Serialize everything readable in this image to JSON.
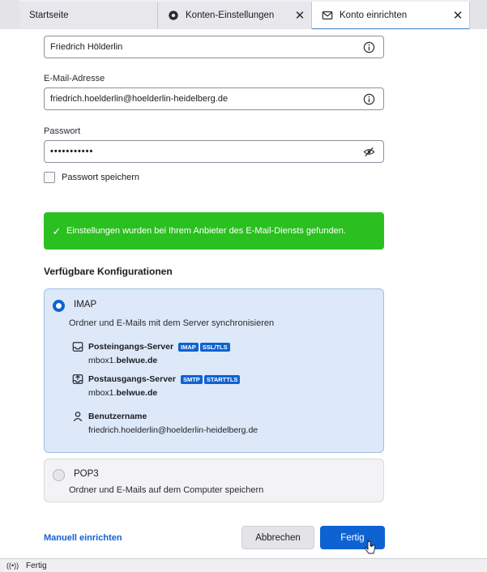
{
  "tabs": [
    {
      "label": "Startseite"
    },
    {
      "label": "Konten-Einstellungen",
      "icon": "gear-icon",
      "close": "✕"
    },
    {
      "label": "Konto einrichten",
      "icon": "envelope-icon",
      "close": "✕"
    }
  ],
  "form": {
    "name_value": "Friedrich Hölderlin",
    "email_label": "E-Mail-Adresse",
    "email_value": "friedrich.hoelderlin@hoelderlin-heidelberg.de",
    "password_label": "Passwort",
    "password_value": "•••••••••••",
    "save_password_label": "Passwort speichern",
    "save_password_checked": false
  },
  "success_message": "Einstellungen wurden bei Ihrem Anbieter des E-Mail-Diensts gefunden.",
  "configs": {
    "title": "Verfügbare Konfigurationen",
    "imap": {
      "name": "IMAP",
      "selected": true,
      "description": "Ordner und E-Mails mit dem Server synchronisieren",
      "incoming": {
        "label": "Posteingangs-Server",
        "badges": [
          "IMAP",
          "SSL/TLS"
        ],
        "host_prefix": "mbox1.",
        "host_domain": "belwue.de"
      },
      "outgoing": {
        "label": "Postausgangs-Server",
        "badges": [
          "SMTP",
          "STARTTLS"
        ],
        "host_prefix": "mbox1.",
        "host_domain": "belwue.de"
      },
      "username": {
        "label": "Benutzername",
        "value": "friedrich.hoelderlin@hoelderlin-heidelberg.de"
      }
    },
    "pop3": {
      "name": "POP3",
      "selected": false,
      "description": "Ordner und E-Mails auf dem Computer speichern"
    }
  },
  "actions": {
    "manual": "Manuell einrichten",
    "cancel": "Abbrechen",
    "done": "Fertig"
  },
  "statusbar": {
    "icon": "((•))",
    "text": "Fertig"
  },
  "colors": {
    "accent": "#0f62d1",
    "success": "#2ac01f",
    "selected_card": "#dde9f8"
  }
}
